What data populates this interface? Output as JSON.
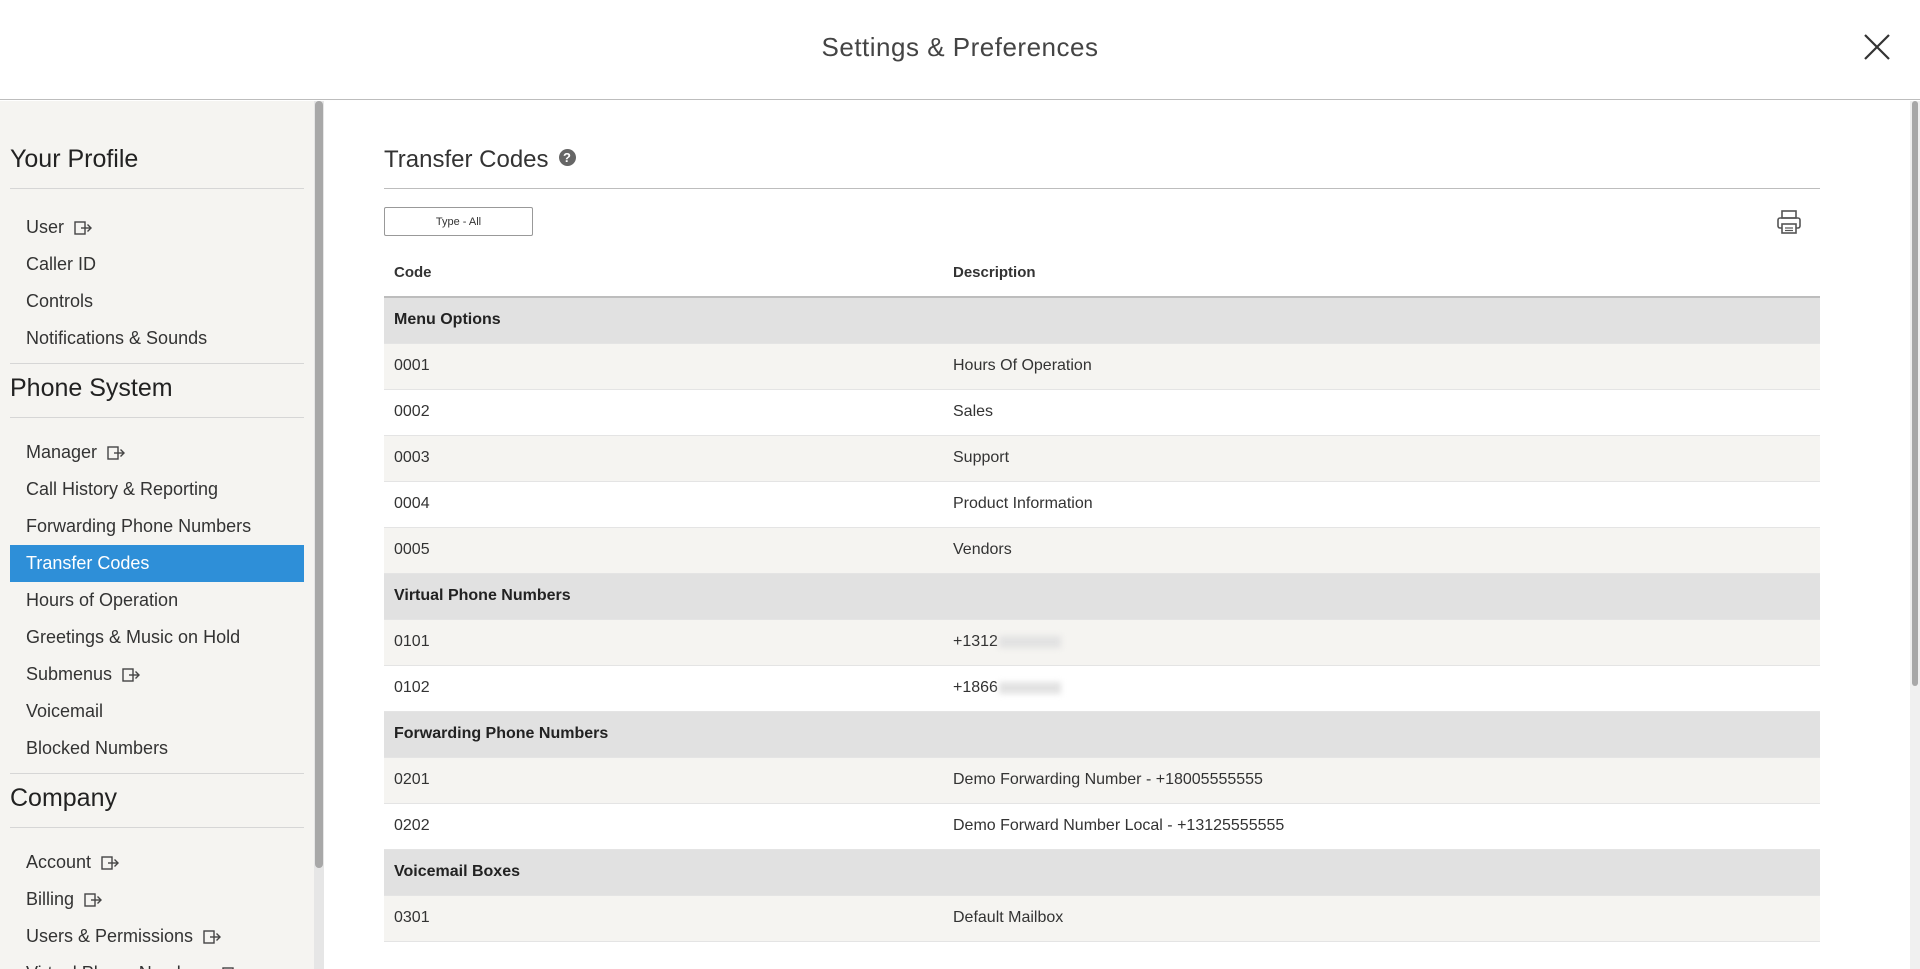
{
  "header": {
    "title": "Settings & Preferences"
  },
  "sidebar": {
    "sections": [
      {
        "title": "Your Profile",
        "items": [
          {
            "label": "User",
            "external": true
          },
          {
            "label": "Caller ID",
            "external": false
          },
          {
            "label": "Controls",
            "external": false
          },
          {
            "label": "Notifications & Sounds",
            "external": false
          }
        ]
      },
      {
        "title": "Phone System",
        "items": [
          {
            "label": "Manager",
            "external": true
          },
          {
            "label": "Call History & Reporting",
            "external": false
          },
          {
            "label": "Forwarding Phone Numbers",
            "external": false
          },
          {
            "label": "Transfer Codes",
            "external": false,
            "active": true
          },
          {
            "label": "Hours of Operation",
            "external": false
          },
          {
            "label": "Greetings & Music on Hold",
            "external": false
          },
          {
            "label": "Submenus",
            "external": true
          },
          {
            "label": "Voicemail",
            "external": false
          },
          {
            "label": "Blocked Numbers",
            "external": false
          }
        ]
      },
      {
        "title": "Company",
        "items": [
          {
            "label": "Account",
            "external": true
          },
          {
            "label": "Billing",
            "external": true
          },
          {
            "label": "Users & Permissions",
            "external": true
          },
          {
            "label": "Virtual Phone Numbers",
            "external": true
          }
        ]
      }
    ]
  },
  "main": {
    "title": "Transfer Codes",
    "help_icon": "?",
    "filter_label": "Type - All",
    "columns": {
      "code": "Code",
      "description": "Description"
    },
    "groups": [
      {
        "name": "Menu Options",
        "rows": [
          {
            "code": "0001",
            "description": "Hours Of Operation"
          },
          {
            "code": "0002",
            "description": "Sales"
          },
          {
            "code": "0003",
            "description": "Support"
          },
          {
            "code": "0004",
            "description": "Product Information"
          },
          {
            "code": "0005",
            "description": "Vendors"
          }
        ]
      },
      {
        "name": "Virtual Phone Numbers",
        "rows": [
          {
            "code": "0101",
            "description": "+1312",
            "redacted": true
          },
          {
            "code": "0102",
            "description": "+1866",
            "redacted": true
          }
        ]
      },
      {
        "name": "Forwarding Phone Numbers",
        "rows": [
          {
            "code": "0201",
            "description": "Demo Forwarding Number - +18005555555"
          },
          {
            "code": "0202",
            "description": "Demo Forward Number Local - +13125555555"
          }
        ]
      },
      {
        "name": "Voicemail Boxes",
        "rows": [
          {
            "code": "0301",
            "description": "Default Mailbox"
          }
        ]
      }
    ]
  },
  "colors": {
    "accent": "#2e8fd8",
    "group_bg": "#e1e1e1",
    "row_alt_bg": "#f5f4f1",
    "sidebar_bg": "#f5f4f1"
  }
}
